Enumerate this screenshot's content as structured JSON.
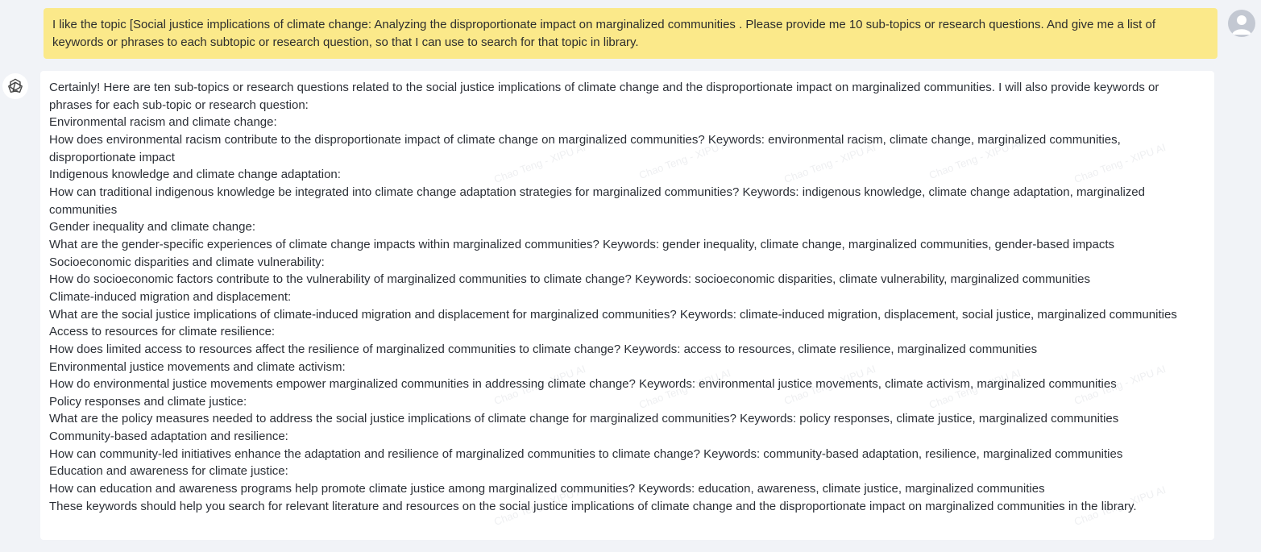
{
  "user_message": {
    "text": "I like the topic [Social justice implications of climate change: Analyzing the disproportionate impact on marginalized communities . Please provide me 10 sub-topics or research questions. And give me a list of keywords or phrases to each subtopic or research question, so that I can use to search for that topic in library."
  },
  "assistant_message": {
    "intro": "Certainly! Here are ten sub-topics or research questions related to the social justice implications of climate change and the disproportionate impact on marginalized communities. I will also provide keywords or phrases for each sub-topic or research question:",
    "items": [
      {
        "heading": "Environmental racism and climate change:",
        "question": "How does environmental racism contribute to the disproportionate impact of climate change on marginalized communities? Keywords: environmental racism, climate change, marginalized communities, disproportionate impact"
      },
      {
        "heading": "Indigenous knowledge and climate change adaptation:",
        "question": "How can traditional indigenous knowledge be integrated into climate change adaptation strategies for marginalized communities? Keywords: indigenous knowledge, climate change adaptation, marginalized communities"
      },
      {
        "heading": "Gender inequality and climate change:",
        "question": "What are the gender-specific experiences of climate change impacts within marginalized communities? Keywords: gender inequality, climate change, marginalized communities, gender-based impacts"
      },
      {
        "heading": "Socioeconomic disparities and climate vulnerability:",
        "question": "How do socioeconomic factors contribute to the vulnerability of marginalized communities to climate change? Keywords: socioeconomic disparities, climate vulnerability, marginalized communities"
      },
      {
        "heading": "Climate-induced migration and displacement:",
        "question": "What are the social justice implications of climate-induced migration and displacement for marginalized communities? Keywords: climate-induced migration, displacement, social justice, marginalized communities"
      },
      {
        "heading": "Access to resources for climate resilience:",
        "question": "How does limited access to resources affect the resilience of marginalized communities to climate change? Keywords: access to resources, climate resilience, marginalized communities"
      },
      {
        "heading": "Environmental justice movements and climate activism:",
        "question": "How do environmental justice movements empower marginalized communities in addressing climate change? Keywords: environmental justice movements, climate activism, marginalized communities"
      },
      {
        "heading": "Policy responses and climate justice:",
        "question": "What are the policy measures needed to address the social justice implications of climate change for marginalized communities? Keywords: policy responses, climate justice, marginalized communities"
      },
      {
        "heading": "Community-based adaptation and resilience:",
        "question": "How can community-led initiatives enhance the adaptation and resilience of marginalized communities to climate change? Keywords: community-based adaptation, resilience, marginalized communities"
      },
      {
        "heading": "Education and awareness for climate justice:",
        "question": "How can education and awareness programs help promote climate justice among marginalized communities? Keywords: education, awareness, climate justice, marginalized communities"
      }
    ],
    "outro": "These keywords should help you search for relevant literature and resources on the social justice implications of climate change and the disproportionate impact on marginalized communities in the library."
  },
  "watermark": {
    "text": "Chao Teng - XIPU AI"
  },
  "icons": {
    "user_avatar": "user-avatar-icon",
    "assistant_avatar": "chatgpt-logo-icon"
  },
  "colors": {
    "page_background": "#f1f3f7",
    "user_bubble": "#fbe98a",
    "assistant_bubble": "#ffffff",
    "avatar_gray": "#c3c8d2"
  }
}
